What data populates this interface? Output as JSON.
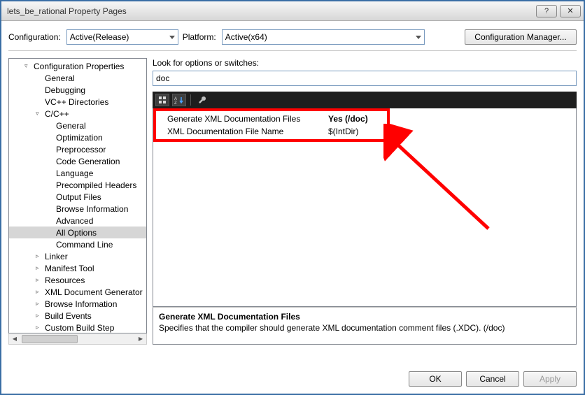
{
  "window": {
    "title": "lets_be_rational Property Pages"
  },
  "config": {
    "label": "Configuration:",
    "value": "Active(Release)",
    "platform_label": "Platform:",
    "platform_value": "Active(x64)",
    "manager_btn": "Configuration Manager..."
  },
  "tree": [
    {
      "label": "Configuration Properties",
      "indent": 1,
      "expander": "▿"
    },
    {
      "label": "General",
      "indent": 2,
      "expander": ""
    },
    {
      "label": "Debugging",
      "indent": 2,
      "expander": ""
    },
    {
      "label": "VC++ Directories",
      "indent": 2,
      "expander": ""
    },
    {
      "label": "C/C++",
      "indent": 2,
      "expander": "▿"
    },
    {
      "label": "General",
      "indent": 3,
      "expander": ""
    },
    {
      "label": "Optimization",
      "indent": 3,
      "expander": ""
    },
    {
      "label": "Preprocessor",
      "indent": 3,
      "expander": ""
    },
    {
      "label": "Code Generation",
      "indent": 3,
      "expander": ""
    },
    {
      "label": "Language",
      "indent": 3,
      "expander": ""
    },
    {
      "label": "Precompiled Headers",
      "indent": 3,
      "expander": ""
    },
    {
      "label": "Output Files",
      "indent": 3,
      "expander": ""
    },
    {
      "label": "Browse Information",
      "indent": 3,
      "expander": ""
    },
    {
      "label": "Advanced",
      "indent": 3,
      "expander": ""
    },
    {
      "label": "All Options",
      "indent": 3,
      "expander": "",
      "selected": true
    },
    {
      "label": "Command Line",
      "indent": 3,
      "expander": ""
    },
    {
      "label": "Linker",
      "indent": 2,
      "expander": "▹"
    },
    {
      "label": "Manifest Tool",
      "indent": 2,
      "expander": "▹"
    },
    {
      "label": "Resources",
      "indent": 2,
      "expander": "▹"
    },
    {
      "label": "XML Document Generator",
      "indent": 2,
      "expander": "▹"
    },
    {
      "label": "Browse Information",
      "indent": 2,
      "expander": "▹"
    },
    {
      "label": "Build Events",
      "indent": 2,
      "expander": "▹"
    },
    {
      "label": "Custom Build Step",
      "indent": 2,
      "expander": "▹"
    }
  ],
  "search": {
    "label": "Look for options or switches:",
    "value": "doc"
  },
  "grid": [
    {
      "name": "Generate XML Documentation Files",
      "value": "Yes (/doc)",
      "bold": true
    },
    {
      "name": "XML Documentation File Name",
      "value": "$(IntDir)",
      "bold": false
    }
  ],
  "desc": {
    "title": "Generate XML Documentation Files",
    "body": "Specifies that the compiler should generate XML documentation comment files (.XDC).     (/doc)"
  },
  "buttons": {
    "ok": "OK",
    "cancel": "Cancel",
    "apply": "Apply"
  }
}
